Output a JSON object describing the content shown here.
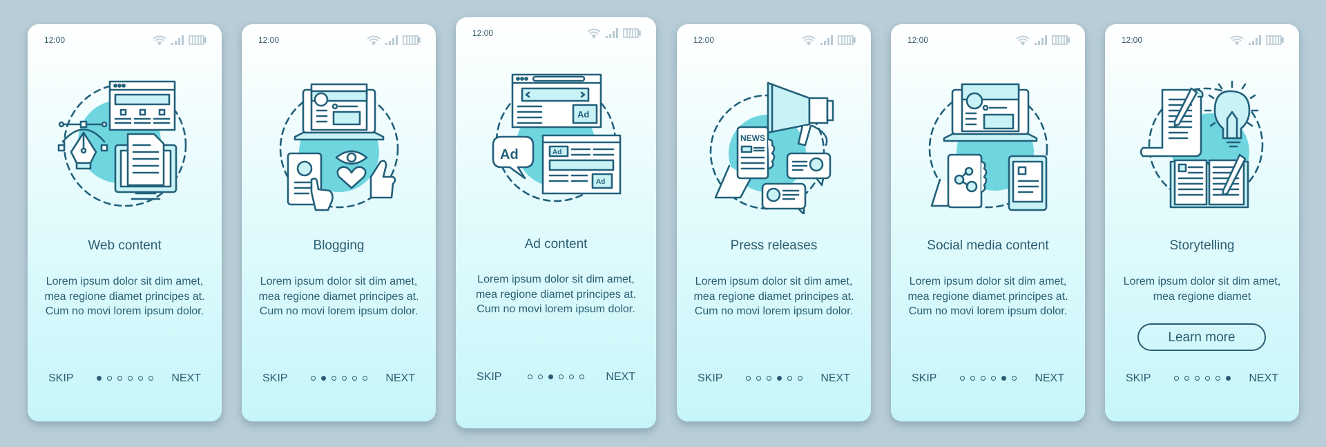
{
  "status_bar": {
    "time": "12:00",
    "icons": [
      "wifi-icon",
      "signal-icon",
      "battery-icon"
    ]
  },
  "colors": {
    "background": "#b8cdd7",
    "text": "#2a5d72",
    "accent_blob": "#6fd6e0",
    "icon_fill": "#c8f2f6",
    "status_icon": "#b9cad3"
  },
  "nav": {
    "skip_label": "SKIP",
    "next_label": "NEXT",
    "total_pages": 6
  },
  "screens": [
    {
      "title": "Web content",
      "illustration": "web-content-illustration",
      "body": "Lorem ipsum dolor sit dim amet, mea regione diamet principes at. Cum no movi lorem ipsum dolor.",
      "active_page": 1
    },
    {
      "title": "Blogging",
      "illustration": "blogging-illustration",
      "body": "Lorem ipsum dolor sit dim amet, mea regione diamet principes at. Cum no movi lorem ipsum dolor.",
      "active_page": 2
    },
    {
      "title": "Ad content",
      "illustration": "ad-content-illustration",
      "body": "Lorem ipsum dolor sit dim amet, mea regione diamet principes at. Cum no movi lorem ipsum dolor.",
      "active_page": 3
    },
    {
      "title": "Press releases",
      "illustration": "press-releases-illustration",
      "body": "Lorem ipsum dolor sit dim amet, mea regione diamet principes at. Cum no movi lorem ipsum dolor.",
      "active_page": 4
    },
    {
      "title": "Social media content",
      "illustration": "social-media-illustration",
      "body": "Lorem ipsum dolor sit dim amet, mea regione diamet principes at. Cum no movi lorem ipsum dolor.",
      "active_page": 5
    },
    {
      "title": "Storytelling",
      "illustration": "storytelling-illustration",
      "body": "Lorem ipsum dolor sit dim amet, mea regione diamet",
      "button_label": "Learn more",
      "active_page": 6
    }
  ]
}
